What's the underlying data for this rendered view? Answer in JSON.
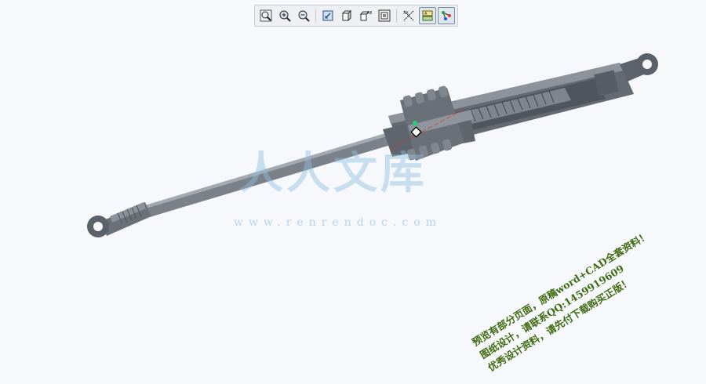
{
  "toolbar": {
    "buttons": [
      {
        "name": "zoom-fit-button",
        "icon": "zoom-fit-icon",
        "active": false
      },
      {
        "name": "zoom-in-button",
        "icon": "zoom-in-icon",
        "active": false
      },
      {
        "name": "zoom-out-button",
        "icon": "zoom-out-icon",
        "active": false
      },
      {
        "name": "repaint-button",
        "icon": "repaint-icon",
        "active": false
      },
      {
        "name": "display-style-button",
        "icon": "cube-icon",
        "active": false
      },
      {
        "name": "saved-views-button",
        "icon": "named-view-icon",
        "active": false
      },
      {
        "name": "view-manager-button",
        "icon": "view-manager-icon",
        "active": false
      },
      {
        "name": "datum-display-button",
        "icon": "datum-axes-icon",
        "active": false
      },
      {
        "name": "plane-display-button",
        "icon": "datum-plane-icon",
        "active": true
      },
      {
        "name": "point-display-button",
        "icon": "datum-point-icon",
        "active": true
      }
    ]
  },
  "watermark": {
    "logo_text": "人人文库",
    "site_text": "www.renrendoc.com"
  },
  "note": {
    "lines": [
      "预览有部分页面，原稿word+CAD全套资料！",
      "图纸设计，请联系QQ:1459919609",
      "优秀设计资料，请先付下载购买正版！"
    ]
  },
  "colors": {
    "background": "#f7f8fb",
    "model": "#6e747b",
    "model_dark": "#4e545b",
    "model_light": "#9aa1a8",
    "note": "#3f6b12",
    "watermark": "#8cbee1"
  }
}
